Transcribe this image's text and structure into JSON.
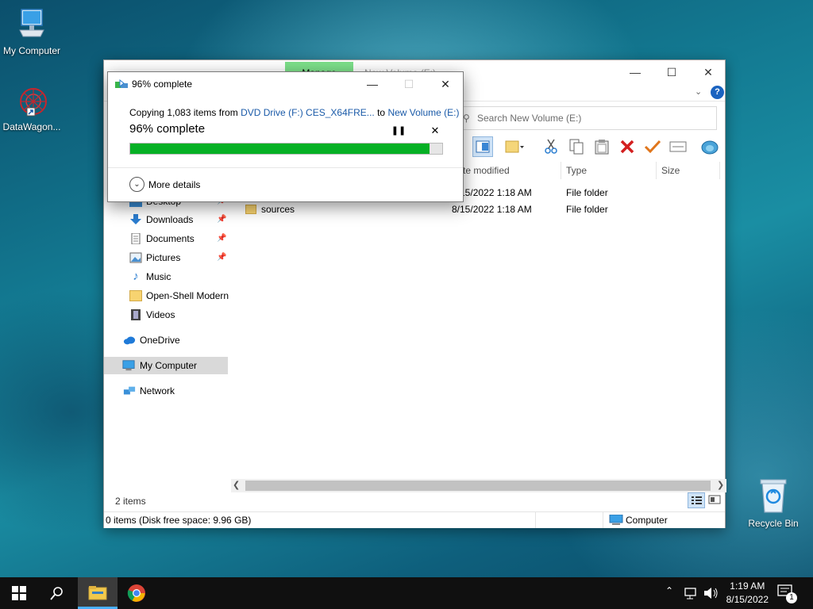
{
  "desktop": {
    "icons": [
      {
        "label": "My Computer"
      },
      {
        "label": "DataWagon..."
      },
      {
        "label": "Recycle Bin"
      }
    ]
  },
  "explorer": {
    "tabs": {
      "manage": "Manage",
      "location": "New Volume (E:)"
    },
    "search_placeholder": "Search New Volume (E:)",
    "columns": {
      "date": "te modified",
      "type": "Type",
      "size": "Size"
    },
    "rows": [
      {
        "name": "",
        "date": "8/15/2022 1:18 AM",
        "type": "File folder"
      },
      {
        "name": "sources",
        "date": "8/15/2022 1:18 AM",
        "type": "File folder"
      }
    ],
    "nav": {
      "desktop": "Desktop",
      "downloads": "Downloads",
      "documents": "Documents",
      "pictures": "Pictures",
      "music": "Music",
      "openshell": "Open-Shell Modern",
      "videos": "Videos",
      "onedrive": "OneDrive",
      "mycomputer": "My Computer",
      "network": "Network"
    },
    "item_count": "2 items",
    "status_left": "0 items (Disk free space: 9.96 GB)",
    "status_right": "Computer"
  },
  "dialog": {
    "title": "96% complete",
    "copy_prefix": "Copying 1,083 items from ",
    "source": "DVD Drive (F:) CES_X64FRE...",
    "to_word": " to ",
    "destination": "New Volume (E:)",
    "percent_text": "96% complete",
    "progress": 0.96,
    "more_details": "More details"
  },
  "taskbar": {
    "time": "1:19 AM",
    "date": "8/15/2022",
    "notification_count": "1"
  },
  "colors": {
    "progress": "#06b025",
    "link": "#1a5aa8",
    "taskbar": "#101010",
    "manage_tab": "#7ddf8a"
  }
}
